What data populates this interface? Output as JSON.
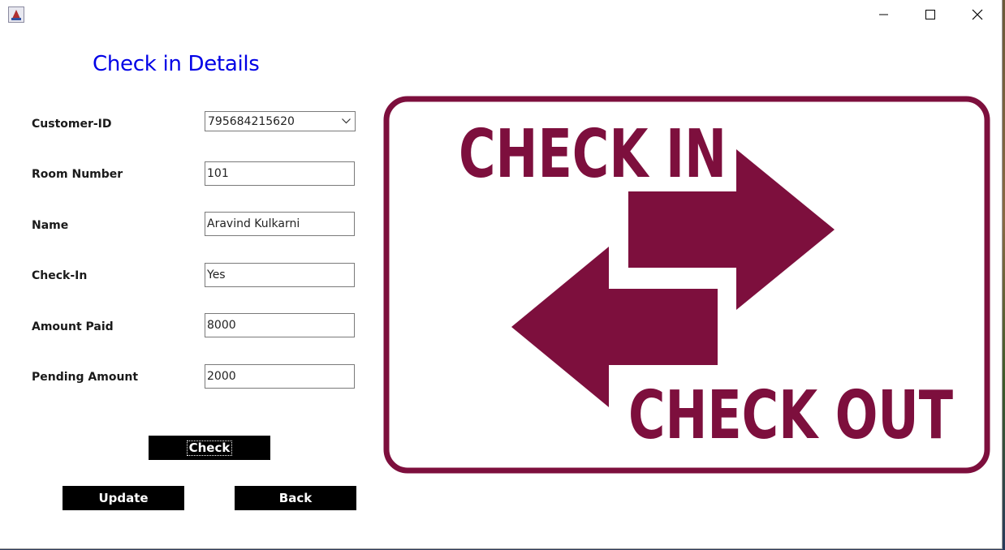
{
  "window": {
    "controls": [
      "minimize",
      "maximize",
      "close"
    ]
  },
  "form": {
    "title": "Check in Details",
    "fields": {
      "customer_id": {
        "label": "Customer-ID",
        "value": "795684215620"
      },
      "room_number": {
        "label": "Room Number",
        "value": "101"
      },
      "name": {
        "label": "Name",
        "value": "Aravind Kulkarni"
      },
      "check_in": {
        "label": "Check-In",
        "value": "Yes"
      },
      "amount_paid": {
        "label": "Amount Paid",
        "value": "8000"
      },
      "pending_amount": {
        "label": "Pending Amount",
        "value": "2000"
      }
    },
    "buttons": {
      "check": "Check",
      "update": "Update",
      "back": "Back"
    }
  },
  "sign": {
    "top_text": "CHECK IN",
    "bottom_text": "CHECK OUT",
    "color": "#7d0f3d"
  }
}
